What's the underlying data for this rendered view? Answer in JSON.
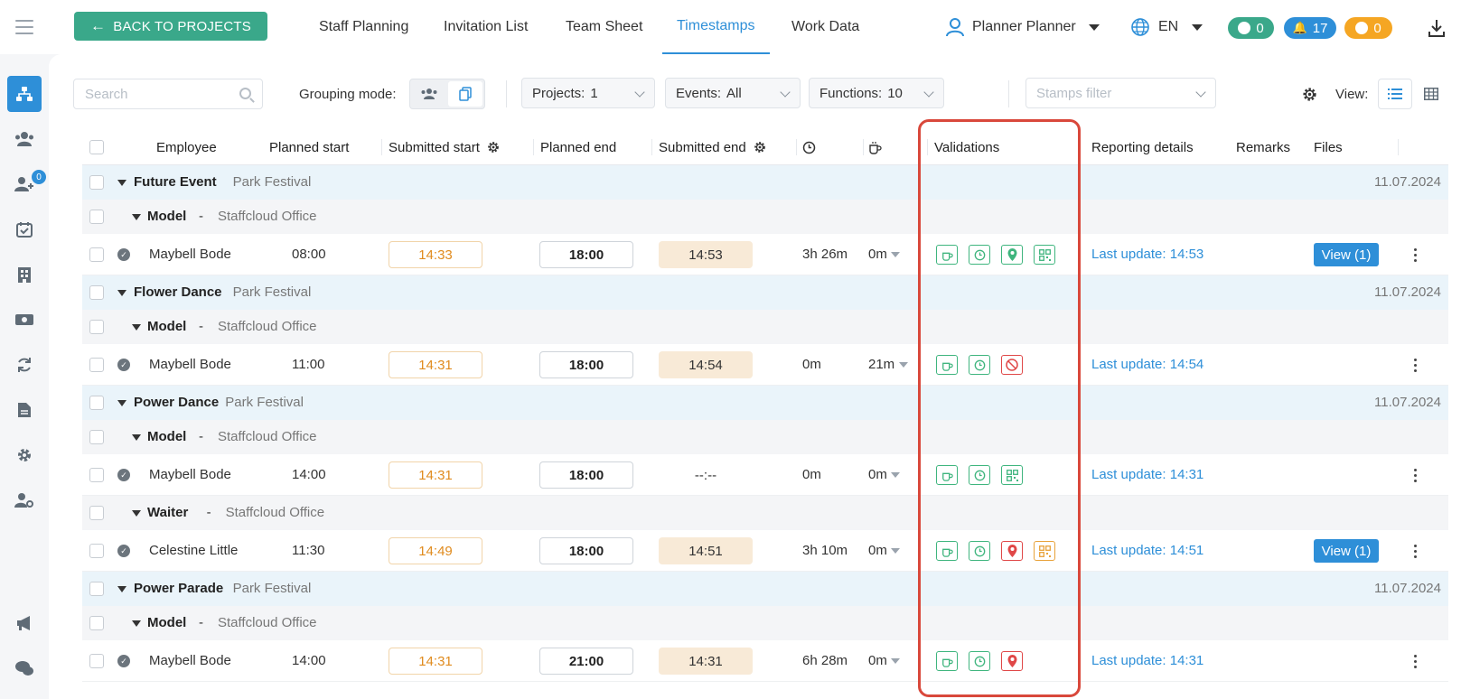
{
  "topbar": {
    "back_label": "BACK TO PROJECTS",
    "tabs": [
      {
        "label": "Staff Planning"
      },
      {
        "label": "Invitation List"
      },
      {
        "label": "Team Sheet"
      },
      {
        "label": "Timestamps"
      },
      {
        "label": "Work Data"
      }
    ],
    "active_tab": "Timestamps",
    "user": "Planner Planner",
    "language": "EN",
    "messages_count": "0",
    "notifications_count": "17",
    "timers_count": "0",
    "colors": {
      "accent": "#2e8fd8",
      "back_button": "#3aa88a",
      "messages": "#3aa88a",
      "notifications": "#2e8fd8",
      "timers": "#f5a623"
    }
  },
  "sidebar": {
    "items": [
      {
        "icon": "org-chart-icon",
        "active": true
      },
      {
        "icon": "users-icon"
      },
      {
        "icon": "add-user-icon",
        "badge": "0"
      },
      {
        "icon": "calendar-check-icon"
      },
      {
        "icon": "building-icon"
      },
      {
        "icon": "money-icon"
      },
      {
        "icon": "sync-icon"
      },
      {
        "icon": "document-icon"
      },
      {
        "icon": "gear-icon"
      },
      {
        "icon": "user-settings-icon"
      },
      {
        "icon": "megaphone-icon"
      },
      {
        "icon": "chat-icon"
      }
    ]
  },
  "toolbar": {
    "search_placeholder": "Search",
    "grouping_label": "Grouping mode:",
    "projects_label": "Projects:",
    "projects_value": "1",
    "events_label": "Events:",
    "events_value": "All",
    "functions_label": "Functions:",
    "functions_value": "10",
    "stamps_placeholder": "Stamps filter",
    "view_label": "View:"
  },
  "table": {
    "headers": {
      "employee": "Employee",
      "planned_start": "Planned start",
      "submitted_start": "Submitted start",
      "planned_end": "Planned end",
      "submitted_end": "Submitted end",
      "validations": "Validations",
      "reporting": "Reporting details",
      "remarks": "Remarks",
      "files": "Files"
    },
    "events": [
      {
        "name": "Future Event",
        "location": "Park Festival",
        "date": "11.07.2024",
        "functions": [
          {
            "name": "Model",
            "dash": "-",
            "place": "Staffcloud Office",
            "employees": [
              {
                "name": "Maybell Bode",
                "planned_start": "08:00",
                "submitted_start": "14:33",
                "planned_end": "18:00",
                "submitted_end": "14:53",
                "duration": "3h 26m",
                "break": "0m",
                "validations": [
                  "g-coffee",
                  "g-clock",
                  "g-pin",
                  "g-qr"
                ],
                "reporting": "Last update: 14:53",
                "files": "View (1)"
              }
            ]
          }
        ]
      },
      {
        "name": "Flower Dance",
        "location": "Park Festival",
        "date": "11.07.2024",
        "functions": [
          {
            "name": "Model",
            "dash": "-",
            "place": "Staffcloud Office",
            "employees": [
              {
                "name": "Maybell Bode",
                "planned_start": "11:00",
                "submitted_start": "14:31",
                "planned_end": "18:00",
                "submitted_end": "14:54",
                "duration": "0m",
                "break": "21m",
                "validations": [
                  "g-coffee",
                  "g-clock",
                  "r-nopin"
                ],
                "reporting": "Last update: 14:54",
                "files": ""
              }
            ]
          }
        ]
      },
      {
        "name": "Power Dance",
        "location": "Park Festival",
        "date": "11.07.2024",
        "functions": [
          {
            "name": "Model",
            "dash": "-",
            "place": "Staffcloud Office",
            "employees": [
              {
                "name": "Maybell Bode",
                "planned_start": "14:00",
                "submitted_start": "14:31",
                "planned_end": "18:00",
                "submitted_end": "--:--",
                "duration": "0m",
                "break": "0m",
                "validations": [
                  "g-coffee",
                  "g-clock",
                  "g-qr"
                ],
                "reporting": "Last update: 14:31",
                "files": ""
              }
            ]
          },
          {
            "name": "Waiter",
            "dash": "-",
            "place": "Staffcloud Office",
            "employees": [
              {
                "name": "Celestine Little",
                "planned_start": "11:30",
                "submitted_start": "14:49",
                "planned_end": "18:00",
                "submitted_end": "14:51",
                "duration": "3h 10m",
                "break": "0m",
                "validations": [
                  "g-coffee",
                  "g-clock",
                  "r-pin",
                  "o-qr"
                ],
                "reporting": "Last update: 14:51",
                "files": "View (1)"
              }
            ]
          }
        ]
      },
      {
        "name": "Power Parade",
        "location": "Park Festival",
        "date": "11.07.2024",
        "functions": [
          {
            "name": "Model",
            "dash": "-",
            "place": "Staffcloud Office",
            "employees": [
              {
                "name": "Maybell Bode",
                "planned_start": "14:00",
                "submitted_start": "14:31",
                "planned_end": "21:00",
                "submitted_end": "14:31",
                "duration": "6h 28m",
                "break": "0m",
                "validations": [
                  "g-coffee",
                  "g-clock",
                  "r-pin"
                ],
                "reporting": "Last update: 14:31",
                "files": ""
              }
            ]
          }
        ]
      }
    ]
  }
}
